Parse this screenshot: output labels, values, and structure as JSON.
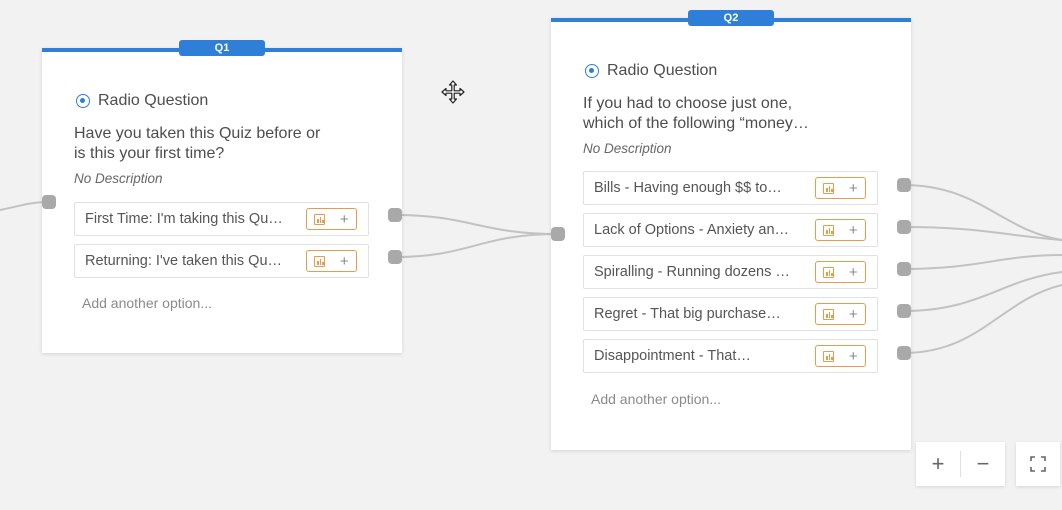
{
  "q1": {
    "badge": "Q1",
    "type_label": "Radio Question",
    "question": "Have you taken this Quiz before or\nis this your first time?",
    "description": "No Description",
    "options": [
      {
        "label": "First Time: I'm taking this Qu…"
      },
      {
        "label": "Returning: I've taken this Qu…"
      }
    ],
    "add_option": "Add another option..."
  },
  "q2": {
    "badge": "Q2",
    "type_label": "Radio Question",
    "question": "If you had to choose just one,\nwhich of the following “money…",
    "description": "No Description",
    "options": [
      {
        "label": "Bills - Having enough $$ to…"
      },
      {
        "label": "Lack of Options - Anxiety an…"
      },
      {
        "label": "Spiralling - Running dozens …"
      },
      {
        "label": "Regret - That big purchase…"
      },
      {
        "label": "Disappointment - That…"
      }
    ],
    "add_option": "Add another option..."
  },
  "controls": {
    "zoom_in": "+",
    "zoom_out": "−",
    "fullscreen_icon": "fullscreen-icon"
  },
  "colors": {
    "accent": "#2f7fd9",
    "option_action": "#e39d4e",
    "connector": "#a9a9a9"
  }
}
